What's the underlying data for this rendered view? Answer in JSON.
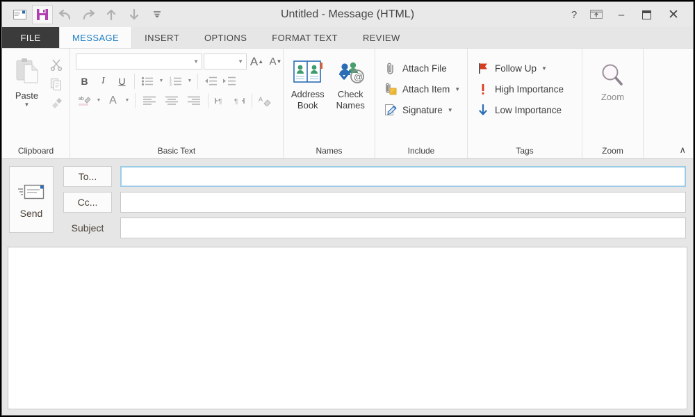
{
  "window": {
    "title": "Untitled - Message (HTML)",
    "quick_access": [
      {
        "name": "envelope-icon",
        "label": "Message"
      },
      {
        "name": "save-icon",
        "label": "Save"
      },
      {
        "name": "undo-icon",
        "label": "Undo"
      },
      {
        "name": "redo-icon",
        "label": "Redo"
      },
      {
        "name": "previous-item-icon",
        "label": "Previous Item"
      },
      {
        "name": "next-item-icon",
        "label": "Next Item"
      },
      {
        "name": "customize-qat-icon",
        "label": "Customize Quick Access Toolbar"
      }
    ],
    "controls": {
      "help": "?",
      "ribbon_display": "ribbon-display-options-icon",
      "minimize": "–",
      "maximize": "❐",
      "close": "✕"
    }
  },
  "tabs": [
    {
      "label": "FILE",
      "active": false,
      "file": true
    },
    {
      "label": "MESSAGE",
      "active": true
    },
    {
      "label": "INSERT",
      "active": false
    },
    {
      "label": "OPTIONS",
      "active": false
    },
    {
      "label": "FORMAT TEXT",
      "active": false
    },
    {
      "label": "REVIEW",
      "active": false
    }
  ],
  "ribbon": {
    "collapse_label": "∧",
    "groups": {
      "clipboard": {
        "label": "Clipboard",
        "paste": "Paste",
        "cut": "Cut",
        "copy": "Copy",
        "format_painter": "Format Painter",
        "has_dialog_launcher": true
      },
      "basic_text": {
        "label": "Basic Text",
        "font_name": "",
        "font_name_placeholder": "",
        "font_size": "",
        "grow_font": "A",
        "shrink_font": "A",
        "bold": "B",
        "italic": "I",
        "underline": "U",
        "bullets": "Bullets",
        "numbering": "Numbering",
        "decrease_indent": "Decrease Indent",
        "increase_indent": "Increase Indent",
        "text_highlight": "Text Highlight Color",
        "font_color": "A",
        "align_left": "Align Left",
        "center": "Center",
        "align_right": "Align Right",
        "ltr": "Left-to-Right Text Direction",
        "rtl": "Right-to-Left Text Direction",
        "clear_formatting": "Clear All Formatting",
        "has_dialog_launcher": true
      },
      "names": {
        "label": "Names",
        "address_book": "Address\nBook",
        "address_book_line1": "Address",
        "address_book_line2": "Book",
        "check_names_line1": "Check",
        "check_names_line2": "Names"
      },
      "include": {
        "label": "Include",
        "items": [
          {
            "label": "Attach File",
            "icon": "paperclip-icon",
            "dropdown": false
          },
          {
            "label": "Attach Item",
            "icon": "attach-item-icon",
            "dropdown": true
          },
          {
            "label": "Signature",
            "icon": "signature-icon",
            "dropdown": true
          }
        ]
      },
      "tags": {
        "label": "Tags",
        "has_dialog_launcher": true,
        "items": [
          {
            "label": "Follow Up",
            "icon": "flag-icon",
            "dropdown": true,
            "color": "#d93b20"
          },
          {
            "label": "High Importance",
            "icon": "exclamation-icon",
            "dropdown": false,
            "color": "#d93b20"
          },
          {
            "label": "Low Importance",
            "icon": "down-arrow-icon",
            "dropdown": false,
            "color": "#2a6db5"
          }
        ]
      },
      "zoom": {
        "label": "Zoom",
        "button_label": "Zoom",
        "icon": "magnifier-icon"
      }
    }
  },
  "composer": {
    "send_label": "Send",
    "send_icon": "send-envelope-icon",
    "to_label": "To...",
    "cc_label": "Cc...",
    "subject_label": "Subject",
    "to_value": "",
    "cc_value": "",
    "subject_value": "",
    "body_value": "",
    "focused_field": "to"
  },
  "colors": {
    "accent": "#1f7fc4",
    "file_tab": "#3b3b3b",
    "save_icon": "#b23fb2",
    "flag_red": "#d93b20",
    "low_importance_blue": "#2a6db5",
    "focus_border": "#9ccbe8"
  }
}
